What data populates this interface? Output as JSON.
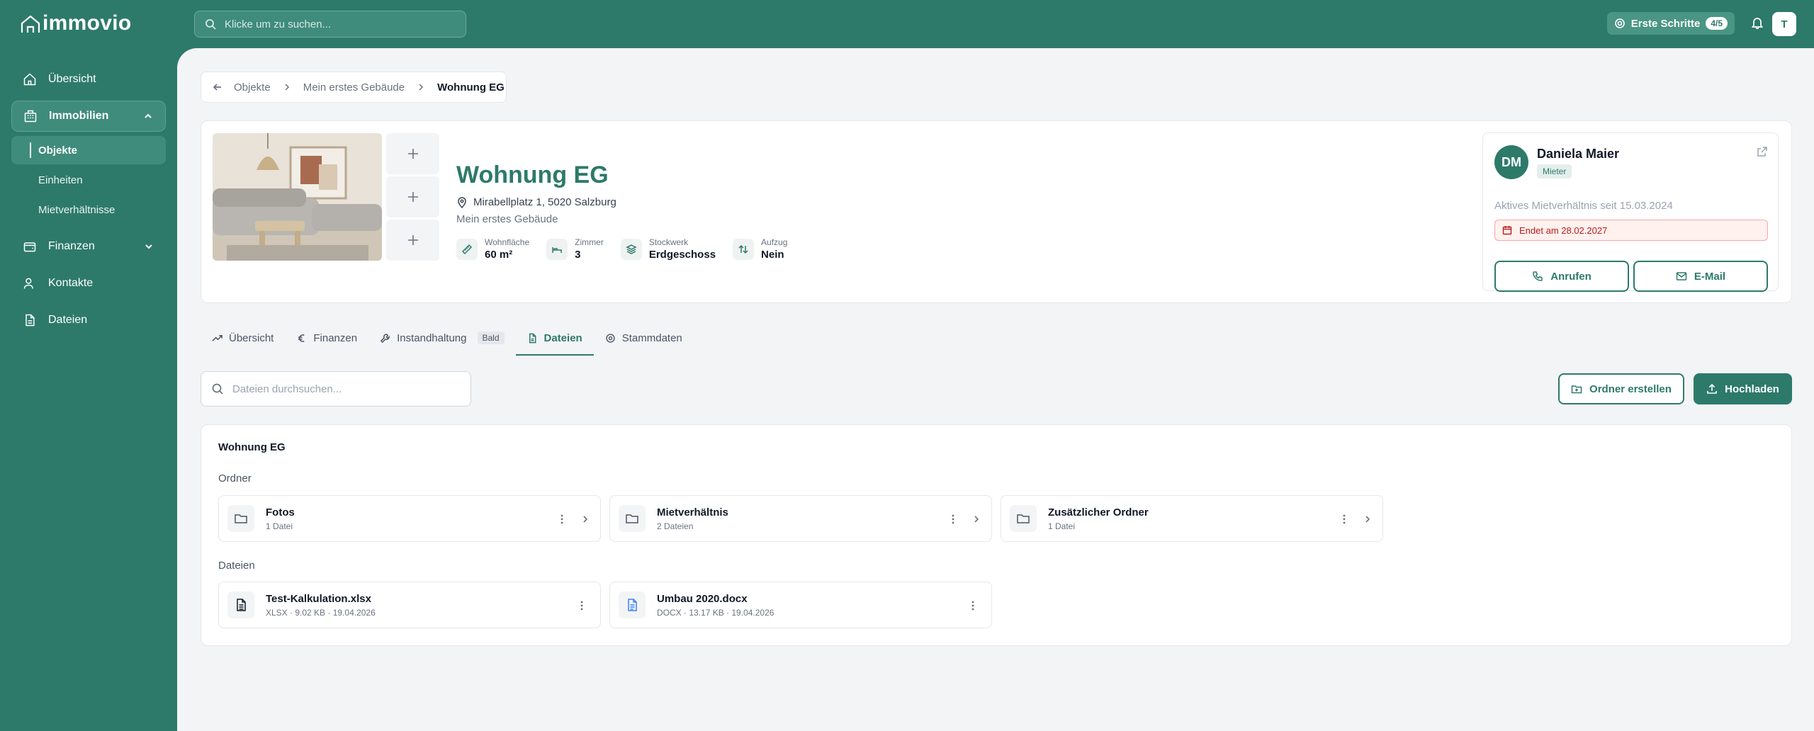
{
  "brand": {
    "logo_text": "immovio"
  },
  "sidebar": {
    "items": [
      {
        "label": "Übersicht",
        "icon": "home-icon"
      },
      {
        "label": "Immobilien",
        "icon": "building-icon"
      },
      {
        "label": "Finanzen",
        "icon": "wallet-icon"
      },
      {
        "label": "Kontakte",
        "icon": "users-icon"
      },
      {
        "label": "Dateien",
        "icon": "file-icon"
      }
    ],
    "sub_items": [
      "Objekte",
      "Einheiten",
      "Mietverhältnisse"
    ]
  },
  "topbar": {
    "search_placeholder": "Klicke um zu suchen...",
    "steps_label": "Erste Schritte",
    "steps_progress": "4/5",
    "user_initial": "T"
  },
  "breadcrumb": {
    "items": [
      "Objekte",
      "Mein erstes Gebäude",
      "Wohnung EG"
    ]
  },
  "property": {
    "title": "Wohnung EG",
    "address": "Mirabellplatz 1, 5020 Salzburg",
    "building": "Mein erstes Gebäude",
    "facts": [
      {
        "label": "Wohnfläche",
        "value": "60 m²",
        "icon": "ruler-icon"
      },
      {
        "label": "Zimmer",
        "value": "3",
        "icon": "bed-icon"
      },
      {
        "label": "Stockwerk",
        "value": "Erdgeschoss",
        "icon": "layers-icon"
      },
      {
        "label": "Aufzug",
        "value": "Nein",
        "icon": "elevator-icon"
      }
    ]
  },
  "tenant": {
    "initials": "DM",
    "name": "Daniela Maier",
    "role": "Mieter",
    "since": "Aktives Mietverhältnis seit 15.03.2024",
    "ends": "Endet am 28.02.2027",
    "call_label": "Anrufen",
    "email_label": "E-Mail"
  },
  "tabs": [
    {
      "label": "Übersicht",
      "icon": "trend-icon"
    },
    {
      "label": "Finanzen",
      "icon": "euro-icon"
    },
    {
      "label": "Instandhaltung",
      "icon": "wrench-icon",
      "badge": "Bald"
    },
    {
      "label": "Dateien",
      "icon": "file-icon",
      "active": true
    },
    {
      "label": "Stammdaten",
      "icon": "gear-icon"
    }
  ],
  "files": {
    "search_placeholder": "Dateien durchsuchen...",
    "create_folder_label": "Ordner erstellen",
    "upload_label": "Hochladen",
    "heading": "Wohnung EG",
    "folders_label": "Ordner",
    "files_label": "Dateien",
    "folders": [
      {
        "name": "Fotos",
        "meta": "1 Datei"
      },
      {
        "name": "Mietverhältnis",
        "meta": "2 Dateien"
      },
      {
        "name": "Zusätzlicher Ordner",
        "meta": "1 Datei"
      }
    ],
    "documents": [
      {
        "name": "Test-Kalkulation.xlsx",
        "meta": "XLSX  ·  9.02 KB  ·  19.04.2026"
      },
      {
        "name": "Umbau 2020.docx",
        "meta": "DOCX  ·  13.17 KB  ·  19.04.2026"
      }
    ]
  },
  "colors": {
    "brand": "#2d7a6a",
    "danger": "#b91c1c",
    "background": "#f3f4f6"
  }
}
